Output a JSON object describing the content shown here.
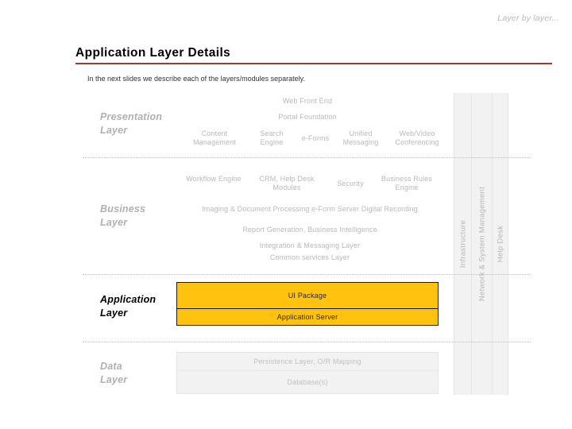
{
  "header": {
    "kicker": "Layer by layer...",
    "title": "Application Layer Details",
    "subtitle": "In the next slides we describe each of the layers/modules separately.",
    "rule_color": "#9e3b35"
  },
  "colors": {
    "highlight_box": "#ffc20e",
    "muted_text": "#b9b9b9",
    "active_label": "#000000",
    "muted_label": "#b0b0b0",
    "panel_fill": "#f2f2f2"
  },
  "layers": {
    "presentation": {
      "label_line1": "Presentation",
      "label_line2": "Layer",
      "active": false,
      "top_rows": [
        "Web Front End",
        "Portal Foundation"
      ],
      "modules": [
        "Content Management",
        "Search Engine",
        "e-Forms",
        "Unified Messaging",
        "Web/Video Conferencing"
      ]
    },
    "business": {
      "label_line1": "Business",
      "label_line2": "Layer",
      "active": false,
      "modules": [
        "Workflow Engine",
        "CRM, Help Desk Modules",
        "Security",
        "Business Rules Engine"
      ],
      "rows": [
        "Imaging & Document Processing  e-Form Server  Digital Recording",
        "Report Generation, Business Intelligence",
        "Integration & Messaging Layer",
        "Common services Layer"
      ]
    },
    "application": {
      "label_line1": "Application",
      "label_line2": "Layer",
      "active": true,
      "boxes": [
        "UI Package",
        "Application Server"
      ]
    },
    "data": {
      "label_line1": "Data",
      "label_line2": "Layer",
      "active": false,
      "boxes": [
        "Persistence Layer, O/R Mapping",
        "Database(s)"
      ]
    }
  },
  "side_columns": [
    "Infrastructure",
    "Network & System Management",
    "Help Desk"
  ]
}
